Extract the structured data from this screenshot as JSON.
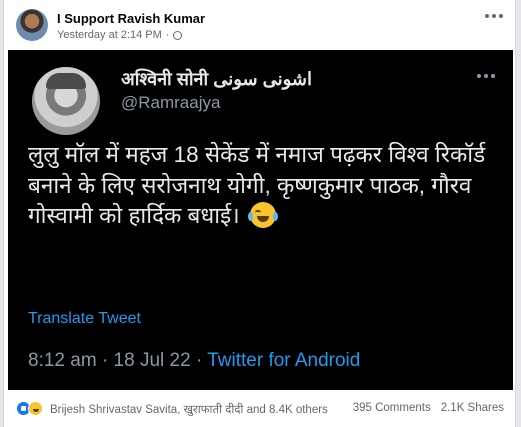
{
  "post": {
    "page_name": "I Support Ravish Kumar",
    "timestamp": "Yesterday at 2:14 PM",
    "privacy_separator": "·"
  },
  "tweet": {
    "display_name": "अश्विनी सोनी اشونی سونی",
    "handle": "@Ramraajya",
    "text": "लुलु मॉल में महज 18 सेकेंड में नमाज पढ़कर विश्व रिकॉर्ड बनाने के लिए सरोजनाथ योगी, कृष्णकुमार पाठक, गौरव गोस्वामी को हार्दिक बधाई।",
    "emoji": "😂",
    "translate_label": "Translate Tweet",
    "time": "8:12 am",
    "separator": "·",
    "date": "18 Jul 22",
    "source": "Twitter for Android"
  },
  "footer": {
    "reactions_text": "Brijesh Shrivastav Savita, खुराफाती दीदी and 8.4K others",
    "comments": "395 Comments",
    "shares": "2.1K Shares"
  },
  "colors": {
    "accent": "#1d9bf0",
    "tweet_bg": "#000000",
    "like_blue": "#1877f2"
  }
}
